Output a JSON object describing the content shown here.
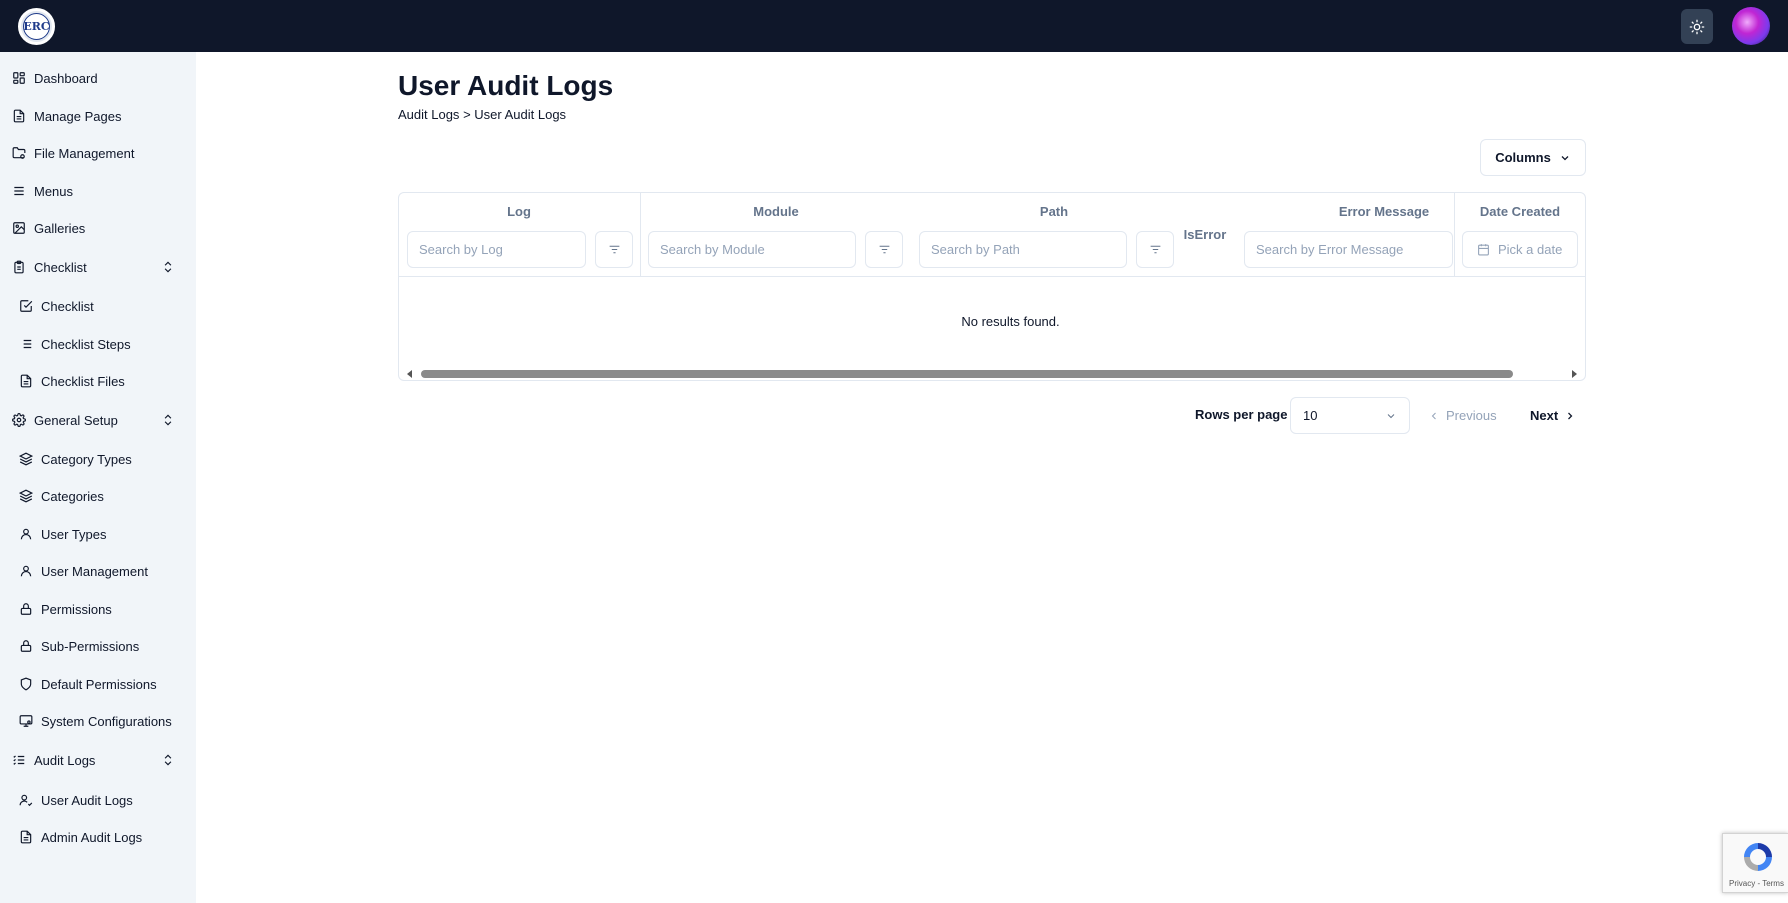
{
  "header": {
    "logo_text": "ERC",
    "theme_toggle_icon": "sun-icon",
    "avatar_icon": "user-avatar"
  },
  "sidebar": {
    "items": [
      {
        "label": "Dashboard",
        "icon": "dashboard-icon"
      },
      {
        "label": "Manage Pages",
        "icon": "file-icon"
      },
      {
        "label": "File Management",
        "icon": "folder-settings-icon"
      },
      {
        "label": "Menus",
        "icon": "menu-icon"
      },
      {
        "label": "Galleries",
        "icon": "image-icon"
      },
      {
        "label": "Checklist",
        "icon": "clipboard-icon",
        "expandable": true
      },
      {
        "label": "Checklist",
        "icon": "check-square-icon"
      },
      {
        "label": "Checklist Steps",
        "icon": "list-icon"
      },
      {
        "label": "Checklist Files",
        "icon": "file-icon"
      },
      {
        "label": "General Setup",
        "icon": "gear-icon",
        "expandable": true
      },
      {
        "label": "Category Types",
        "icon": "layers-icon"
      },
      {
        "label": "Categories",
        "icon": "layers-icon"
      },
      {
        "label": "User Types",
        "icon": "user-icon"
      },
      {
        "label": "User Management",
        "icon": "user-icon"
      },
      {
        "label": "Permissions",
        "icon": "lock-icon"
      },
      {
        "label": "Sub-Permissions",
        "icon": "lock-icon"
      },
      {
        "label": "Default Permissions",
        "icon": "shield-icon"
      },
      {
        "label": "System Configurations",
        "icon": "monitor-settings-icon"
      },
      {
        "label": "Audit Logs",
        "icon": "list-check-icon",
        "expandable": true
      },
      {
        "label": "User Audit Logs",
        "icon": "user-check-icon"
      },
      {
        "label": "Admin Audit Logs",
        "icon": "file-icon"
      }
    ]
  },
  "main": {
    "title": "User Audit Logs",
    "breadcrumb": {
      "parent": "Audit Logs",
      "separator": ">",
      "current": "User Audit Logs"
    },
    "columns_button": "Columns",
    "table": {
      "columns": [
        {
          "header": "Log",
          "placeholder": "Search by Log"
        },
        {
          "header": "Module",
          "placeholder": "Search by Module"
        },
        {
          "header": "Path",
          "placeholder": "Search by Path"
        },
        {
          "header": "IsError"
        },
        {
          "header": "Error Message",
          "placeholder": "Search by Error Message"
        },
        {
          "header": "Date Created",
          "placeholder": "Pick a date"
        }
      ],
      "empty_message": "No results found."
    },
    "pagination": {
      "rows_per_page_label": "Rows per page",
      "rows_per_page_value": "10",
      "previous_label": "Previous",
      "next_label": "Next"
    }
  },
  "recaptcha": {
    "text": "Privacy - Terms"
  },
  "colors": {
    "topbar": "#0f172a",
    "sidebar_bg": "#f1f5f9",
    "border": "#e2e8f0",
    "muted_text": "#64748b"
  }
}
